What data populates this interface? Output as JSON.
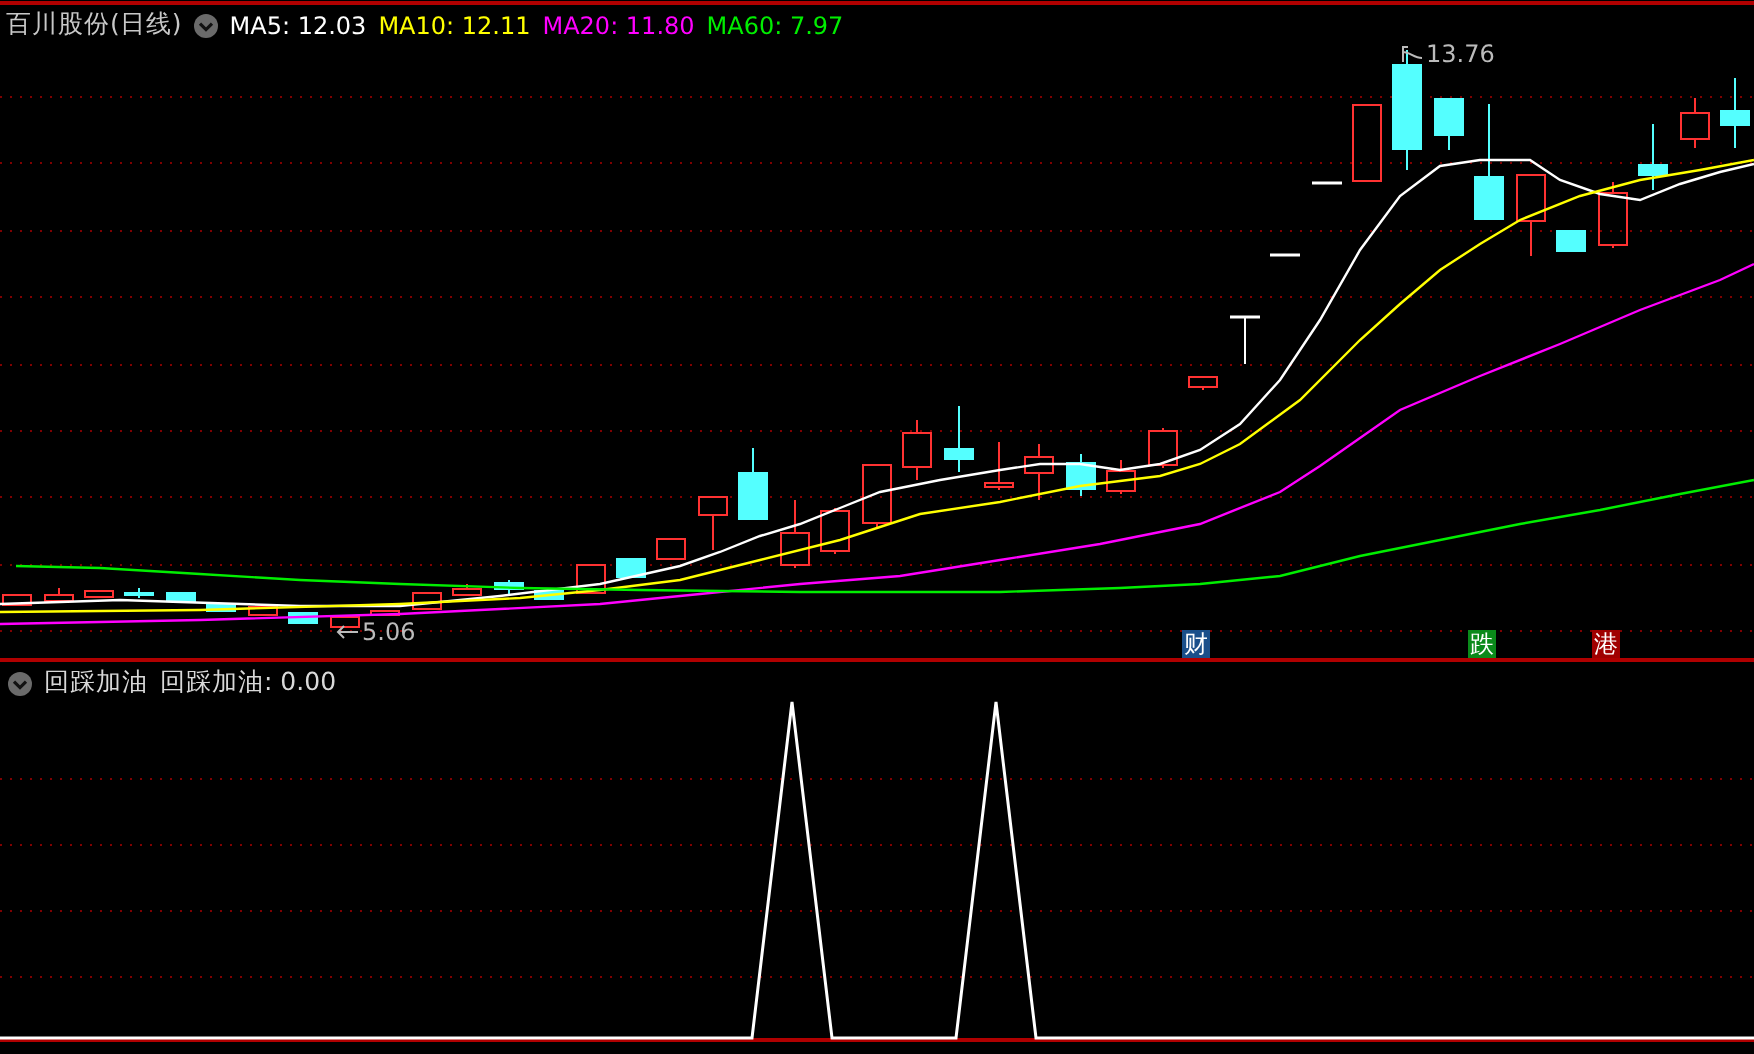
{
  "main_panel": {
    "title": "百川股份(日线)",
    "indicators": [
      {
        "label": "MA5: 12.03",
        "color": "#ffffff"
      },
      {
        "label": "MA10: 12.11",
        "color": "#ffff00"
      },
      {
        "label": "MA20: 11.80",
        "color": "#ff00ff"
      },
      {
        "label": "MA60: 7.97",
        "color": "#00ee00"
      }
    ],
    "price_labels": [
      {
        "kind": "high",
        "text": "13.76"
      },
      {
        "kind": "low",
        "text": "5.06"
      }
    ],
    "event_markers": [
      {
        "text": "财",
        "color": "#1a4f8a"
      },
      {
        "text": "跌",
        "color": "#0a8a1a"
      },
      {
        "text": "港",
        "color": "#a00000"
      }
    ]
  },
  "indicator_panel": {
    "name": "回踩加油",
    "reading": "回踩加油: 0.00"
  }
}
